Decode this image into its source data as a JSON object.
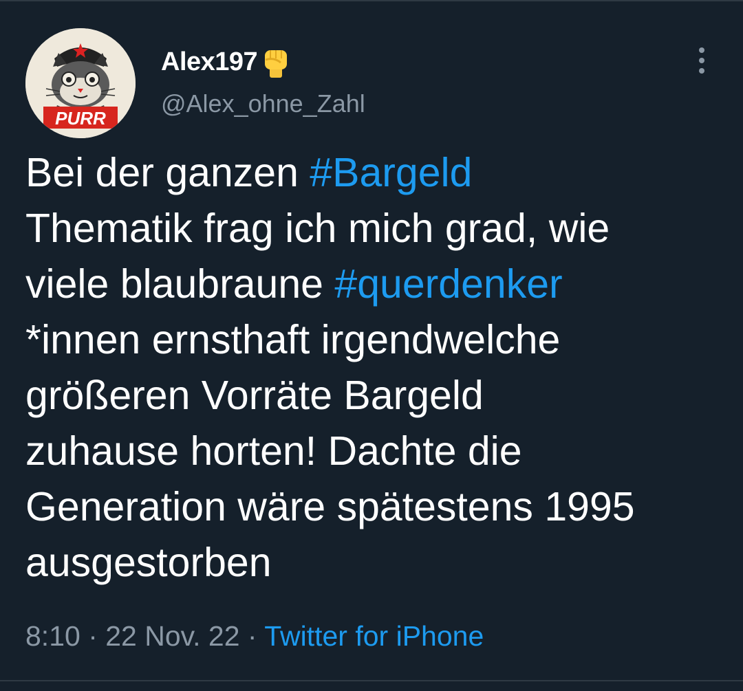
{
  "author": {
    "display_name": "Alex197",
    "handle": "@Alex_ohne_Zahl",
    "avatar_badge": "PURR",
    "name_emoji_icon": "raised-fist-icon"
  },
  "tweet": {
    "lines": [
      {
        "text_before": "Bei der ganzen ",
        "hashtag": "#Bargeld",
        "text_after": ""
      },
      {
        "text_before": "Thematik frag ich mich grad, wie",
        "hashtag": "",
        "text_after": ""
      },
      {
        "text_before": "viele blaubraune ",
        "hashtag": "#querdenker",
        "text_after": ""
      },
      {
        "text_before": "*innen ernsthaft irgendwelche",
        "hashtag": "",
        "text_after": ""
      },
      {
        "text_before": "größeren Vorräte Bargeld",
        "hashtag": "",
        "text_after": ""
      },
      {
        "text_before": "zuhause horten! Dachte die",
        "hashtag": "",
        "text_after": ""
      },
      {
        "text_before": "Generation wäre spätestens 1995",
        "hashtag": "",
        "text_after": ""
      },
      {
        "text_before": "ausgestorben",
        "hashtag": "",
        "text_after": ""
      }
    ]
  },
  "meta": {
    "time": "8:10",
    "separator": " · ",
    "date": "22 Nov. 22",
    "source": "Twitter for iPhone"
  },
  "colors": {
    "background": "#15202b",
    "text": "#ffffff",
    "secondary": "#8b98a5",
    "accent": "#1d9bf0"
  },
  "icons": {
    "more": "more-vertical-icon"
  }
}
